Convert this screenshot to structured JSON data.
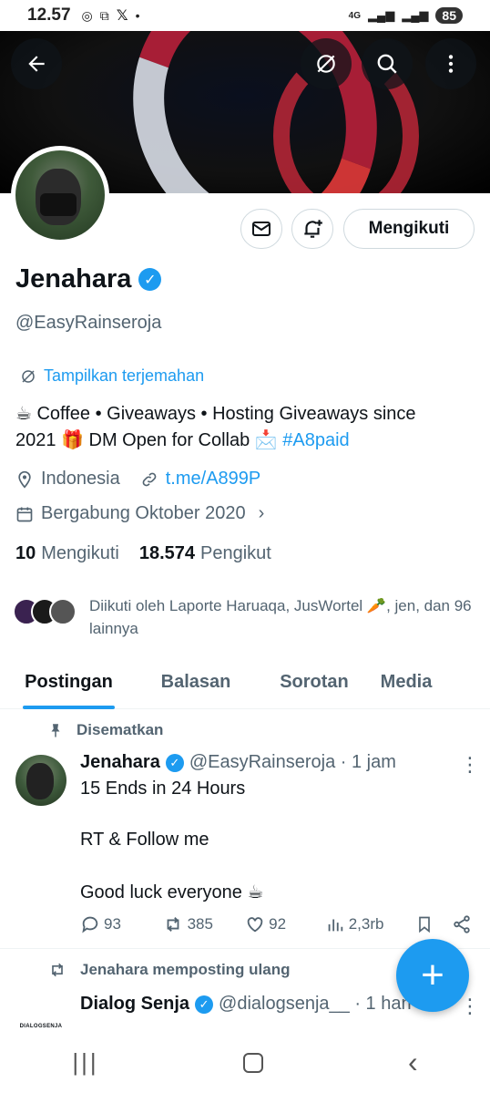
{
  "status_bar": {
    "time": "12.57",
    "network": "4G",
    "battery": "85"
  },
  "profile": {
    "name": "Jenahara",
    "handle": "@EasyRainseroja",
    "translate_label": "Tampilkan terjemahan",
    "bio_line1": "☕ Coffee • Giveaways • Hosting Giveaways since",
    "bio_line2_pre": "2021 🎁 DM Open for Collab 📩 ",
    "bio_hashtag": "#A8paid",
    "location": "Indonesia",
    "link": "t.me/A899P",
    "joined": "Bergabung Oktober 2020",
    "following_count": "10",
    "following_label": "Mengikuti",
    "followers_count": "18.574",
    "followers_label": "Pengikut",
    "followed_by": "Diikuti oleh Laporte Haruaqa, JusWortel 🥕, jen, dan 96 lainnya",
    "follow_button": "Mengikuti"
  },
  "tabs": [
    {
      "label": "Postingan",
      "active": true
    },
    {
      "label": "Balasan"
    },
    {
      "label": "Sorotan"
    },
    {
      "label": "Media"
    }
  ],
  "pinned_post": {
    "pinned_label": "Disematkan",
    "author": "Jenahara",
    "handle_time": "@EasyRainseroja · 1 jam",
    "line1": "15 Ends in 24 Hours",
    "line2": "RT & Follow me",
    "line3": "Good luck everyone ☕",
    "replies": "93",
    "reposts": "385",
    "likes": "92",
    "views": "2,3rb"
  },
  "repost": {
    "label": "Jenahara memposting ulang",
    "author": "Dialog Senja",
    "handle_time": "@dialogsenja__ · 1 han",
    "avatar_text": "DIALOGSENJA"
  },
  "icons": {
    "back": "back-arrow-icon",
    "translate": "translate-off-icon",
    "search": "search-icon",
    "more": "more-vertical-icon",
    "mail": "mail-icon",
    "bell": "bell-plus-icon",
    "fab": "plus-icon"
  },
  "colors": {
    "accent": "#1d9bf0",
    "text": "#0f1419",
    "muted": "#536471"
  }
}
